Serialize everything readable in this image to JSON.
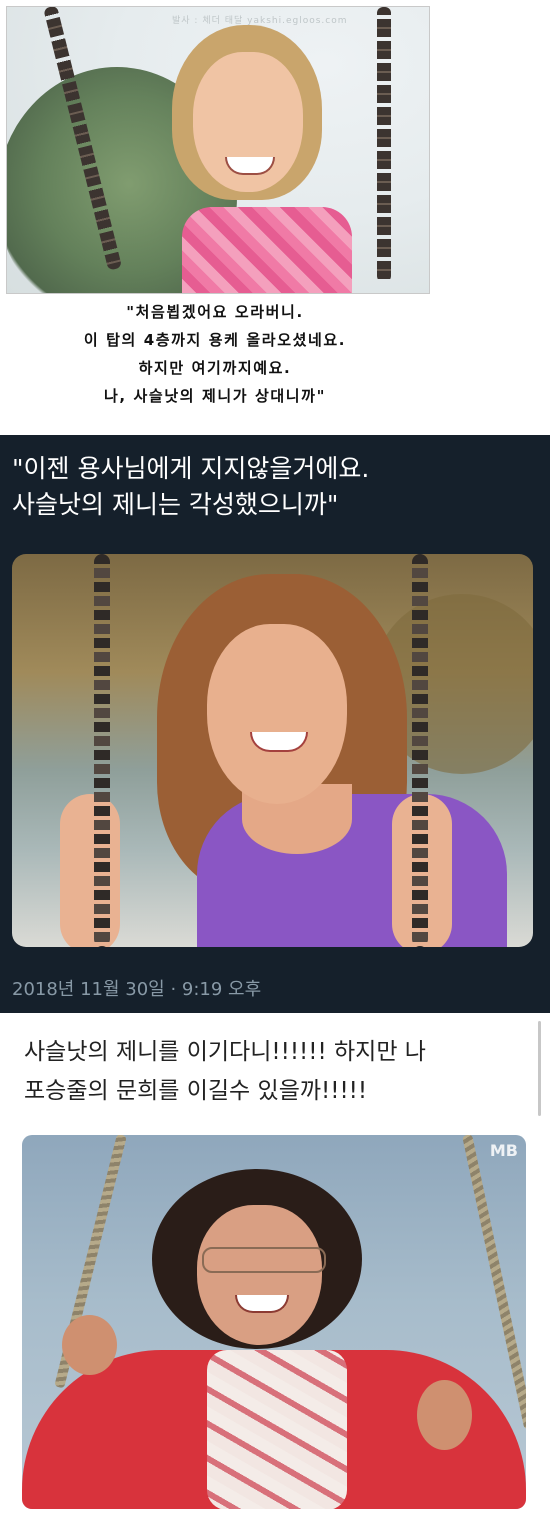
{
  "panel1": {
    "watermark": "발사 : 체더 태달 yakshi.egloos.com",
    "caption_lines": [
      "\"처음뵙겠어요 오라버니.",
      "이 탑의 4층까지 용케 올라오셨네요.",
      "하지만 여기까지예요.",
      "나, 사슬낫의 제니가 상대니까\""
    ]
  },
  "panel2": {
    "quote_lines": [
      "\"이젠 용사님에게 지지않을거에요.",
      "사슬낫의 제니는 각성했으니까\""
    ],
    "timestamp": "2018년 11월 30일 · 9:19 오후"
  },
  "panel3": {
    "text_lines": [
      "사슬낫의 제니를 이기다니!!!!!! 하지만 나",
      "포승줄의 문희를 이길수 있을까!!!!!"
    ],
    "broadcast_logo": "MB"
  },
  "colors": {
    "dark_panel": "#15202b",
    "timestamp": "#8899a6"
  }
}
